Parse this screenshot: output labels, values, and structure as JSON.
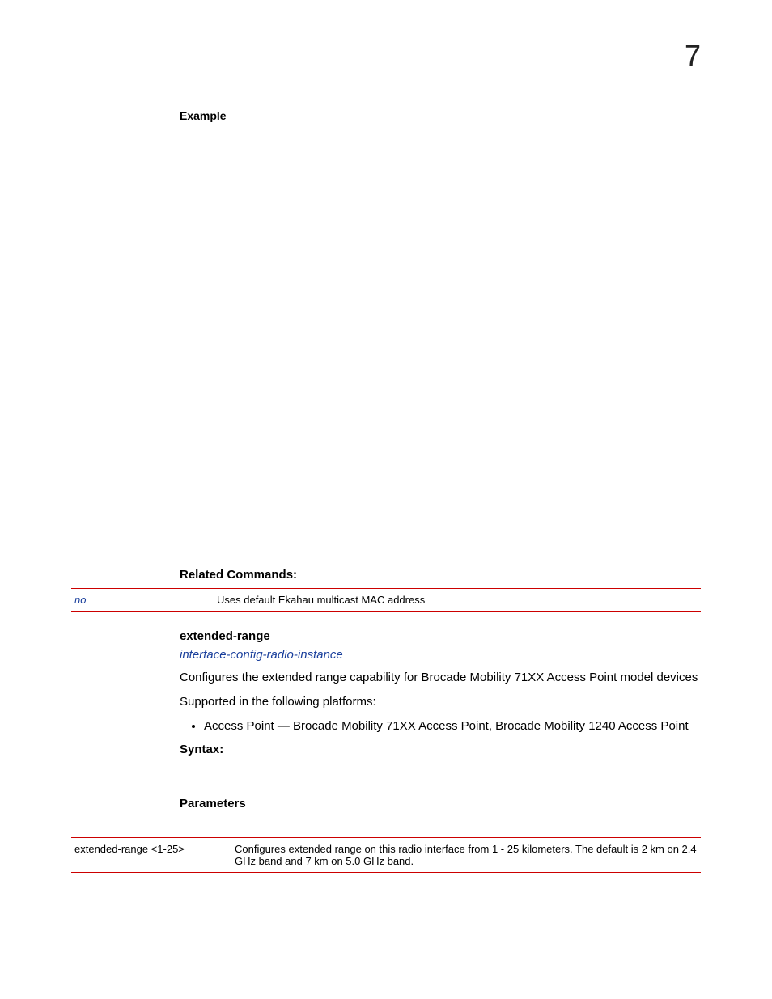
{
  "chapterNumber": "7",
  "exampleLabel": "Example",
  "relatedCommandsHeading": "Related Commands:",
  "relatedCommands": {
    "cmd": "no",
    "desc": "Uses default Ekahau multicast MAC address"
  },
  "commandName": "extended-range",
  "contextLink": "interface-config-radio-instance",
  "description": "Configures the extended range capability for Brocade Mobility 71XX Access Point model devices",
  "supportedIntro": "Supported in the following platforms:",
  "supportedBullet": "Access Point — Brocade Mobility 71XX Access Point, Brocade Mobility 1240 Access Point",
  "syntaxHeading": "Syntax:",
  "parametersHeading": "Parameters",
  "paramTable": {
    "param": "extended-range <1-25>",
    "desc": "Configures extended range on this radio interface from 1 - 25 kilometers. The default is 2 km on 2.4 GHz band and 7 km on 5.0 GHz band."
  }
}
